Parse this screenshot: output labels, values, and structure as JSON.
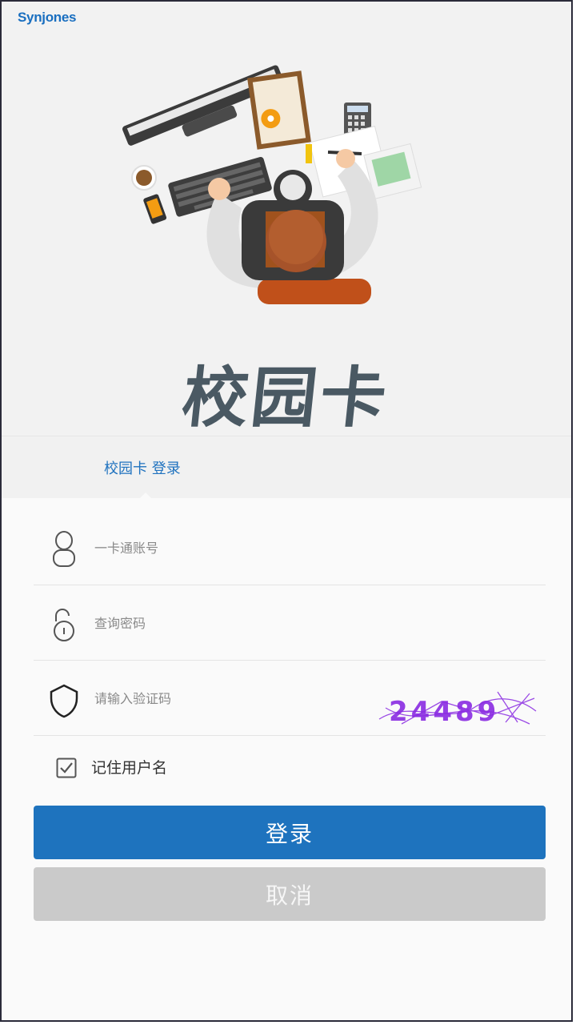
{
  "header": {
    "logo_text": "Synjones",
    "app_title": "校园卡"
  },
  "login_tab": {
    "label": "校园卡 登录"
  },
  "form": {
    "account": {
      "placeholder": "一卡通账号",
      "value": ""
    },
    "password": {
      "placeholder": "查询密码",
      "value": ""
    },
    "captcha": {
      "placeholder": "请输入验证码",
      "value": "",
      "image_text": "24489"
    },
    "remember": {
      "label": "记住用户名",
      "checked": true
    }
  },
  "buttons": {
    "login": "登录",
    "cancel": "取消"
  },
  "colors": {
    "primary": "#1e73be",
    "cancel": "#cacaca",
    "captcha": "#8a2be2",
    "title": "#4a5963"
  }
}
